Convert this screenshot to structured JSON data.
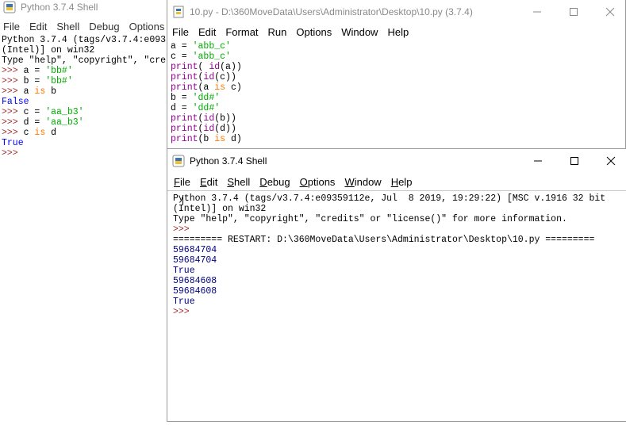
{
  "bg_shell": {
    "title": "Python 3.7.4 Shell",
    "menus": [
      "File",
      "Edit",
      "Shell",
      "Debug",
      "Options"
    ],
    "lines": [
      [
        {
          "t": "Python 3.7.4 (tags/v3.7.4:e093",
          "c": "def"
        }
      ],
      [
        {
          "t": "(Intel)] on win32",
          "c": "def"
        }
      ],
      [
        {
          "t": "Type \"help\", \"copyright\", \"cre",
          "c": "def"
        }
      ],
      [
        {
          "t": ">>> ",
          "c": "prompt"
        },
        {
          "t": "a = ",
          "c": "def"
        },
        {
          "t": "'bb#'",
          "c": "str"
        }
      ],
      [
        {
          "t": ">>> ",
          "c": "prompt"
        },
        {
          "t": "b = ",
          "c": "def"
        },
        {
          "t": "'bb#'",
          "c": "str"
        }
      ],
      [
        {
          "t": ">>> ",
          "c": "prompt"
        },
        {
          "t": "a ",
          "c": "def"
        },
        {
          "t": "is",
          "c": "kw"
        },
        {
          "t": " b",
          "c": "def"
        }
      ],
      [
        {
          "t": "False",
          "c": "res"
        }
      ],
      [
        {
          "t": ">>> ",
          "c": "prompt"
        },
        {
          "t": "c = ",
          "c": "def"
        },
        {
          "t": "'aa_b3'",
          "c": "str"
        }
      ],
      [
        {
          "t": ">>> ",
          "c": "prompt"
        },
        {
          "t": "d = ",
          "c": "def"
        },
        {
          "t": "'aa_b3'",
          "c": "str"
        }
      ],
      [
        {
          "t": ">>> ",
          "c": "prompt"
        },
        {
          "t": "c ",
          "c": "def"
        },
        {
          "t": "is",
          "c": "kw"
        },
        {
          "t": " d",
          "c": "def"
        }
      ],
      [
        {
          "t": "True",
          "c": "res"
        }
      ],
      [
        {
          "t": ">>>",
          "c": "prompt"
        }
      ]
    ]
  },
  "editor": {
    "title": "10.py - D:\\360MoveData\\Users\\Administrator\\Desktop\\10.py (3.7.4)",
    "menus": [
      "File",
      "Edit",
      "Format",
      "Run",
      "Options",
      "Window",
      "Help"
    ],
    "lines": [
      [
        {
          "t": "a = ",
          "c": "def"
        },
        {
          "t": "'abb_c'",
          "c": "str"
        }
      ],
      [
        {
          "t": "c = ",
          "c": "def"
        },
        {
          "t": "'abb_c'",
          "c": "str"
        }
      ],
      [
        {
          "t": "print",
          "c": "builtin"
        },
        {
          "t": "( ",
          "c": "def"
        },
        {
          "t": "id",
          "c": "builtin"
        },
        {
          "t": "(a))",
          "c": "def"
        }
      ],
      [
        {
          "t": "print",
          "c": "builtin"
        },
        {
          "t": "(",
          "c": "def"
        },
        {
          "t": "id",
          "c": "builtin"
        },
        {
          "t": "(c))",
          "c": "def"
        }
      ],
      [
        {
          "t": "print",
          "c": "builtin"
        },
        {
          "t": "(a ",
          "c": "def"
        },
        {
          "t": "is",
          "c": "kw"
        },
        {
          "t": " c)",
          "c": "def"
        }
      ],
      [
        {
          "t": "b = ",
          "c": "def"
        },
        {
          "t": "'dd#'",
          "c": "str"
        }
      ],
      [
        {
          "t": "d = ",
          "c": "def"
        },
        {
          "t": "'dd#'",
          "c": "str"
        }
      ],
      [
        {
          "t": "print",
          "c": "builtin"
        },
        {
          "t": "(",
          "c": "def"
        },
        {
          "t": "id",
          "c": "builtin"
        },
        {
          "t": "(b))",
          "c": "def"
        }
      ],
      [
        {
          "t": "print",
          "c": "builtin"
        },
        {
          "t": "(",
          "c": "def"
        },
        {
          "t": "id",
          "c": "builtin"
        },
        {
          "t": "(d))",
          "c": "def"
        }
      ],
      [
        {
          "t": "print",
          "c": "builtin"
        },
        {
          "t": "(b ",
          "c": "def"
        },
        {
          "t": "is",
          "c": "kw"
        },
        {
          "t": " d)",
          "c": "def"
        }
      ]
    ]
  },
  "fg_shell": {
    "title": "Python 3.7.4 Shell",
    "menus": [
      {
        "label": "File",
        "u": "F",
        "rest": "ile"
      },
      {
        "label": "Edit",
        "u": "E",
        "rest": "dit"
      },
      {
        "label": "Shell",
        "u": "S",
        "rest": "hell",
        "upos": "start"
      },
      {
        "label": "Debug",
        "u": "D",
        "rest": "ebug"
      },
      {
        "label": "Options",
        "u": "O",
        "rest": "ptions"
      },
      {
        "label": "Window",
        "u": "W",
        "rest": "indow"
      },
      {
        "label": "Help",
        "u": "H",
        "rest": "elp"
      }
    ],
    "lines": [
      [
        {
          "t": "Python 3.7.4 (tags/v3.7.4:e09359112e, Jul  8 2019, 19:29:22) [MSC v.1916 32 bit",
          "c": "def"
        }
      ],
      [
        {
          "t": "(Intel)] on win32",
          "c": "def"
        }
      ],
      [
        {
          "t": "Type \"help\", \"copyright\", \"credits\" or \"license()\" for more information.",
          "c": "def"
        }
      ],
      [
        {
          "t": ">>> ",
          "c": "prompt"
        }
      ],
      [
        {
          "t": "========= RESTART: D:\\360MoveData\\Users\\Administrator\\Desktop\\10.py =========",
          "c": "def"
        }
      ],
      [
        {
          "t": "59684704",
          "c": "out"
        }
      ],
      [
        {
          "t": "59684704",
          "c": "out"
        }
      ],
      [
        {
          "t": "True",
          "c": "out"
        }
      ],
      [
        {
          "t": "59684608",
          "c": "out"
        }
      ],
      [
        {
          "t": "59684608",
          "c": "out"
        }
      ],
      [
        {
          "t": "True",
          "c": "out"
        }
      ],
      [
        {
          "t": ">>> ",
          "c": "prompt"
        }
      ]
    ]
  },
  "colors": {
    "string": "#00aa00",
    "keyword": "#ff7700",
    "builtin": "#900090",
    "prompt": "#a52a2a",
    "output": "#000080",
    "result": "#0000ff"
  }
}
